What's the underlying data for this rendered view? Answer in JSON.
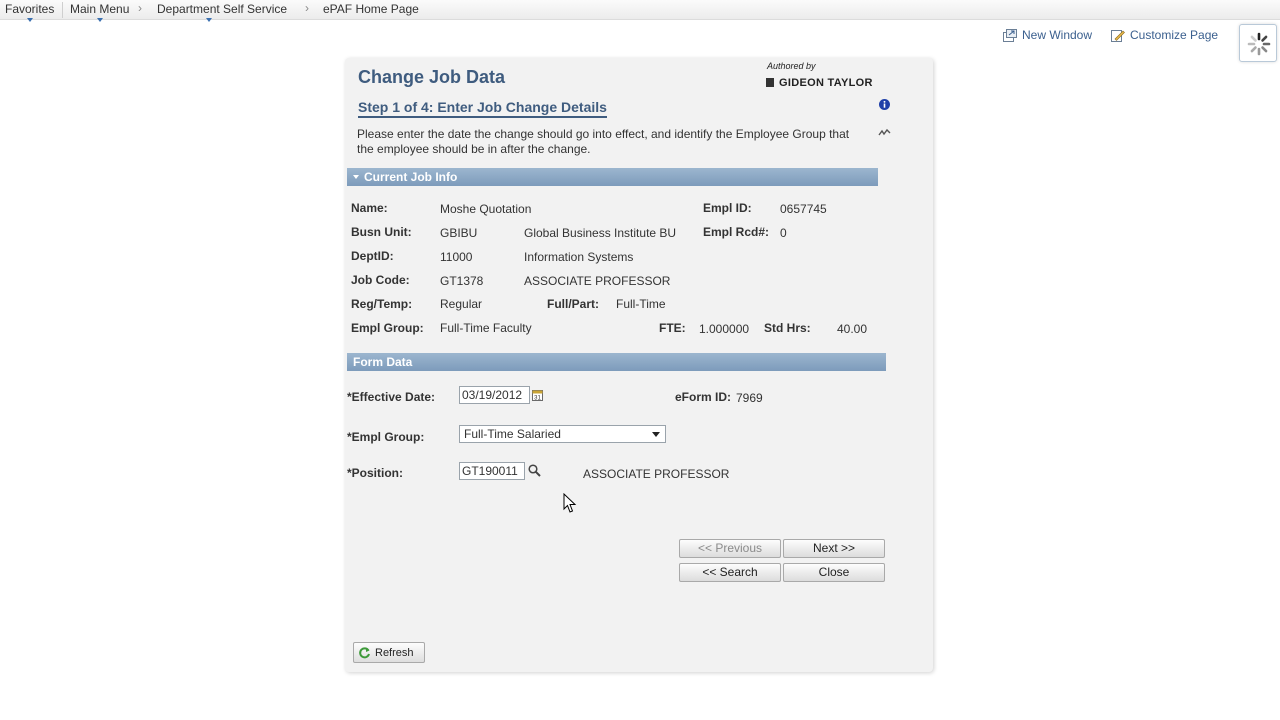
{
  "nav": {
    "favorites": "Favorites",
    "main_menu": "Main Menu",
    "dept_self_service": "Department Self Service",
    "epaf_home": "ePAF Home Page"
  },
  "toolbar": {
    "new_window": "New Window",
    "customize_page": "Customize Page"
  },
  "header": {
    "title": "Change Job Data",
    "step": "Step 1 of 4: Enter Job Change Details",
    "authored_by": "Authored by",
    "vendor": "GIDEON TAYLOR",
    "intro": "Please enter the date the change should go into effect, and identify the Employee Group that the employee should be in after the change."
  },
  "current_job": {
    "section_title": "Current Job Info",
    "name_label": "Name:",
    "name_value": "Moshe Quotation",
    "emplid_label": "Empl ID:",
    "emplid_value": "0657745",
    "busunit_label": "Busn Unit:",
    "busunit_code": "GBIBU",
    "busunit_desc": "Global Business Institute BU",
    "emplrcd_label": "Empl Rcd#:",
    "emplrcd_value": "0",
    "deptid_label": "DeptID:",
    "deptid_code": "11000",
    "deptid_desc": "Information Systems",
    "jobcode_label": "Job Code:",
    "jobcode_code": "GT1378",
    "jobcode_desc": "ASSOCIATE PROFESSOR",
    "regtemp_label": "Reg/Temp:",
    "regtemp_value": "Regular",
    "fullpart_label": "Full/Part:",
    "fullpart_value": "Full-Time",
    "emplgroup_label": "Empl Group:",
    "emplgroup_value": "Full-Time Faculty",
    "fte_label": "FTE:",
    "fte_value": "1.000000",
    "stdhrs_label": "Std Hrs:",
    "stdhrs_value": "40.00"
  },
  "form": {
    "section_title": "Form Data",
    "effdate_label": "*Effective Date:",
    "effdate_value": "03/19/2012",
    "eform_label": "eForm ID:",
    "eform_value": "7969",
    "emplgroup_label": "*Empl Group:",
    "emplgroup_value": "Full-Time Salaried",
    "position_label": "*Position:",
    "position_value": "GT190011",
    "position_desc": "ASSOCIATE PROFESSOR"
  },
  "buttons": {
    "previous": "<< Previous",
    "next": "Next >>",
    "search": "<< Search",
    "close": "Close",
    "refresh": "Refresh"
  },
  "colors": {
    "title": "#3f5c7f",
    "section_bar": "#8aa7c4",
    "link": "#3a5f8e"
  },
  "icons": [
    "chevron-down-icon",
    "new-window-icon",
    "customize-page-icon",
    "loading-spinner-icon",
    "info-icon",
    "collapse-icon",
    "calendar-icon",
    "lookup-icon",
    "refresh-icon",
    "mouse-cursor-icon"
  ]
}
